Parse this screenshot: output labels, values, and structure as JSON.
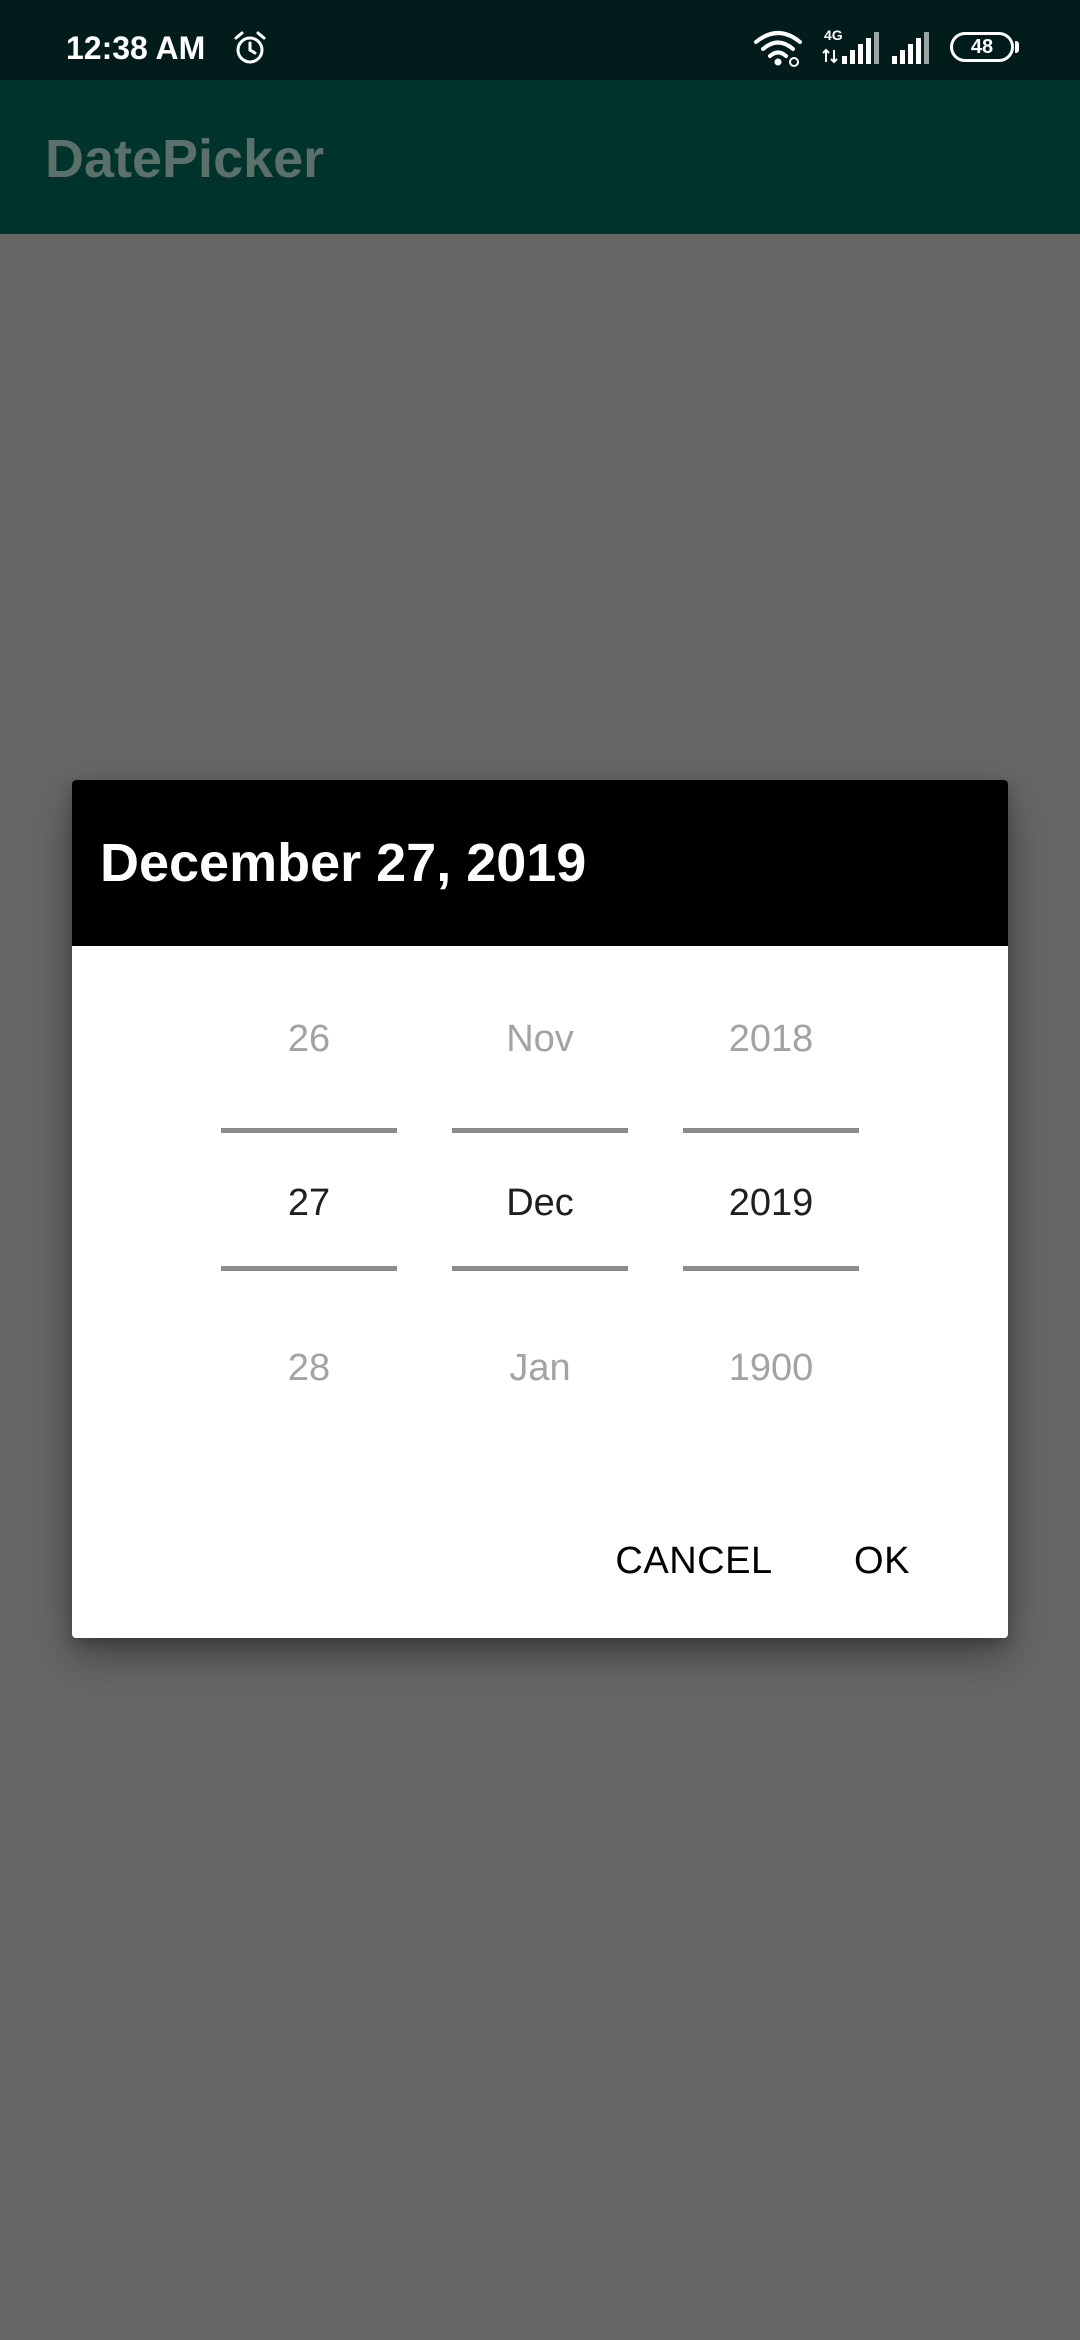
{
  "status_bar": {
    "time": "12:38 AM",
    "network": "4G",
    "battery": "48",
    "icons": [
      "alarm-icon",
      "wifi-icon",
      "cellular-signal-icon",
      "cellular-signal-icon",
      "battery-icon"
    ]
  },
  "app_bar": {
    "title": "DatePicker"
  },
  "dialog": {
    "header_date": "December 27, 2019",
    "day": {
      "prev": "26",
      "current": "27",
      "next": "28"
    },
    "month": {
      "prev": "Nov",
      "current": "Dec",
      "next": "Jan"
    },
    "year": {
      "prev": "2018",
      "current": "2019",
      "next": "1900"
    },
    "cancel_label": "CANCEL",
    "ok_label": "OK"
  },
  "colors": {
    "status_bar_bg": "#011c1a",
    "app_bar_bg": "#01332d",
    "scrim": "#666666",
    "dialog_header_bg": "#000000",
    "dialog_bg": "#ffffff"
  }
}
